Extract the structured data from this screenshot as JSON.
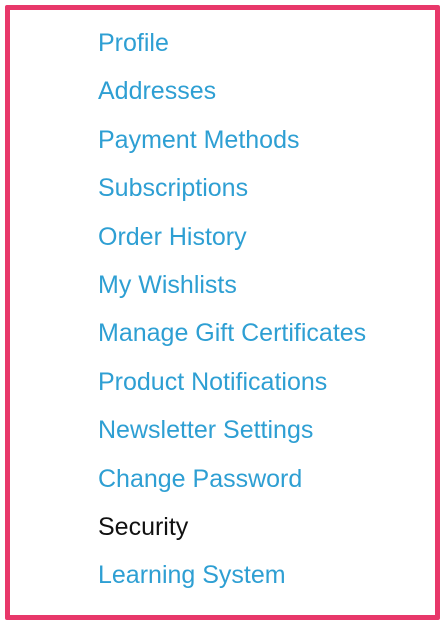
{
  "account_menu": {
    "items": [
      {
        "label": "Profile",
        "active": false
      },
      {
        "label": "Addresses",
        "active": false
      },
      {
        "label": "Payment Methods",
        "active": false
      },
      {
        "label": "Subscriptions",
        "active": false
      },
      {
        "label": "Order History",
        "active": false
      },
      {
        "label": "My Wishlists",
        "active": false
      },
      {
        "label": "Manage Gift Certificates",
        "active": false
      },
      {
        "label": "Product Notifications",
        "active": false
      },
      {
        "label": "Newsletter Settings",
        "active": false
      },
      {
        "label": "Change Password",
        "active": false
      },
      {
        "label": "Security",
        "active": true
      },
      {
        "label": "Learning System",
        "active": false
      }
    ]
  },
  "colors": {
    "frame_border": "#e8386a",
    "link": "#2e9fd3",
    "active_text": "#111111"
  }
}
